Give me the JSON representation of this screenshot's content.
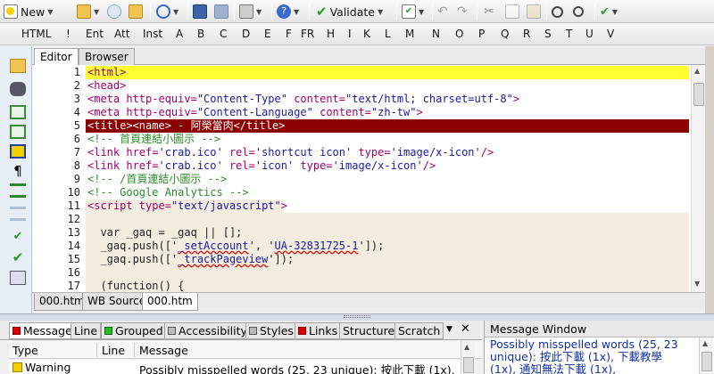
{
  "toolbar": {
    "new_label": "New",
    "validate_label": "Validate"
  },
  "tag_bar": {
    "items": [
      "HTML",
      "!",
      "Ent",
      "Att",
      "Inst",
      "A",
      "B",
      "C",
      "D",
      "E",
      "F",
      "FR",
      "H",
      "I",
      "K",
      "L",
      "M",
      "N",
      "O",
      "P",
      "Q",
      "R",
      "S",
      "T",
      "U",
      "V"
    ]
  },
  "editor_tabs": [
    "Editor",
    "Browser"
  ],
  "line_numbers": [
    "1",
    "2",
    "3",
    "4",
    "5",
    "6",
    "7",
    "8",
    "9",
    "10",
    "11",
    "12",
    "13",
    "14",
    "15",
    "16",
    "17"
  ],
  "code_lines": {
    "l1": "<html>",
    "l2": "<head>",
    "l3a": "<meta http-equiv=",
    "l3b": "\"Content-Type\"",
    "l3c": " content=",
    "l3d": "\"text/html; charset=utf-8\"",
    "l3e": ">",
    "l4a": "<meta http-equiv=",
    "l4b": "\"Content-Language\"",
    "l4c": " content=",
    "l4d": "\"zh-tw\"",
    "l4e": ">",
    "l5": "<title><name> - 阿榮當肉</title>",
    "l6": "<!-- 首頁連結小圖示 -->",
    "l7a": "<link href=",
    "l7b": "'crab.ico'",
    "l7c": " rel=",
    "l7d": "'shortcut icon'",
    "l7e": " type=",
    "l7f": "'image/x-icon'",
    "l7g": "/>",
    "l8a": "<link href=",
    "l8b": "'crab.ico'",
    "l8c": " rel=",
    "l8d": "'icon'",
    "l8e": " type=",
    "l8f": "'image/x-icon'",
    "l8g": "/>",
    "l9": "<!-- /首頁連結小圖示 -->",
    "l10": "<!-- Google Analytics -->",
    "l11a": "<script type=",
    "l11b": "\"text/javascript\"",
    "l11c": ">",
    "l12": "",
    "l13": "  var _gaq = _gaq || [];",
    "l14a": "  _gaq.push(['",
    "l14b": "_setAccount",
    "l14c": "', '",
    "l14d": "UA-32831725-1",
    "l14e": "']);",
    "l15a": "  _gaq.push(['",
    "l15b": "_trackPageview",
    "l15c": "']);",
    "l16": "",
    "l17": "  (function() {"
  },
  "doc_tabs": [
    "000.htm",
    "WB Source",
    "000.htm"
  ],
  "bottom_tabs": [
    "Message",
    "Line",
    "Grouped",
    "Accessibility",
    "Styles",
    "Links",
    "Structure",
    "Scratch"
  ],
  "bottom_table": {
    "headers": [
      "Type",
      "Line",
      "Message"
    ],
    "rows": [
      {
        "type": "Warning",
        "line": "",
        "message": "Possibly misspelled words (25, 23 unique): 按此下載 (1x),"
      }
    ]
  },
  "message_window": {
    "title": "Message Window",
    "text": "Possibly misspelled words (25, 23 unique): 按此下載 (1x), 下載教學 (1x), 通知無法下載 (1x),"
  },
  "colors": {
    "current_line": "#ffff33",
    "selected_line": "#8b0000",
    "tag_color": "#a0006a",
    "value_color": "#1a1aa0",
    "comment_color": "#2c8c2c"
  }
}
